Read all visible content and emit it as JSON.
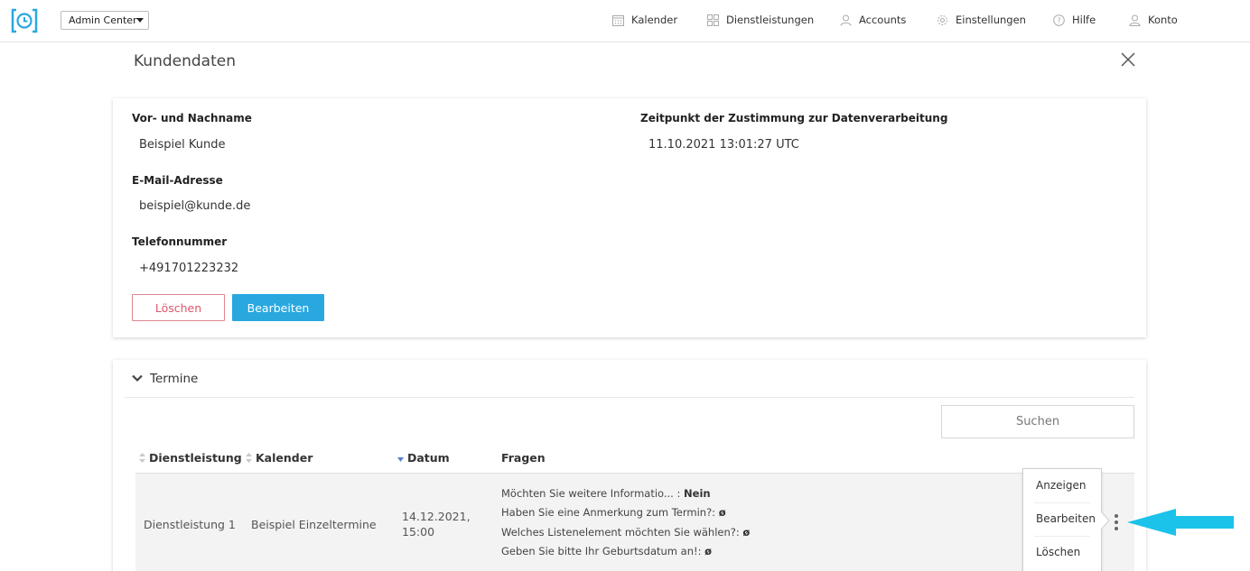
{
  "topbar": {
    "app_switcher": "Admin Center",
    "nav": [
      {
        "label": "Kalender",
        "icon": "calendar-icon"
      },
      {
        "label": "Dienstleistungen",
        "icon": "grid-icon"
      },
      {
        "label": "Accounts",
        "icon": "accounts-icon"
      },
      {
        "label": "Einstellungen",
        "icon": "gear-icon"
      },
      {
        "label": "Hilfe",
        "icon": "help-icon"
      },
      {
        "label": "Konto",
        "icon": "user-icon"
      }
    ]
  },
  "page": {
    "title": "Kundendaten"
  },
  "customer": {
    "name_label": "Vor- und Nachname",
    "name_value": "Beispiel Kunde",
    "email_label": "E-Mail-Adresse",
    "email_value": "beispiel@kunde.de",
    "phone_label": "Telefonnummer",
    "phone_value": "+491701223232",
    "consent_label": "Zeitpunkt der Zustimmung zur Datenverarbeitung",
    "consent_value": "11.10.2021 13:01:27 UTC",
    "delete_label": "Löschen",
    "edit_label": "Bearbeiten"
  },
  "appointments": {
    "title": "Termine",
    "search_placeholder": "Suchen",
    "columns": [
      "Dienstleistung",
      "Kalender",
      "Datum",
      "Fragen"
    ],
    "rows": [
      {
        "service": "Dienstleistung 1",
        "calendar": "Beispiel Einzeltermine",
        "date_line1": "14.12.2021,",
        "date_line2": "15:00",
        "questions": [
          {
            "q": "Möchten Sie weitere Informatio... :",
            "a": "Nein"
          },
          {
            "q": "Haben Sie eine Anmerkung zum Termin?:",
            "a": "ø"
          },
          {
            "q": "Welches Listenelement möchten Sie wählen?:",
            "a": "ø"
          },
          {
            "q": "Geben Sie bitte Ihr Geburtsdatum an!:",
            "a": "ø"
          }
        ]
      }
    ],
    "row_menu": [
      "Anzeigen",
      "Bearbeiten",
      "Löschen"
    ]
  },
  "colors": {
    "accent": "#29a8e0",
    "danger": "#e0566a",
    "pointer_arrow": "#1bc2ea"
  }
}
